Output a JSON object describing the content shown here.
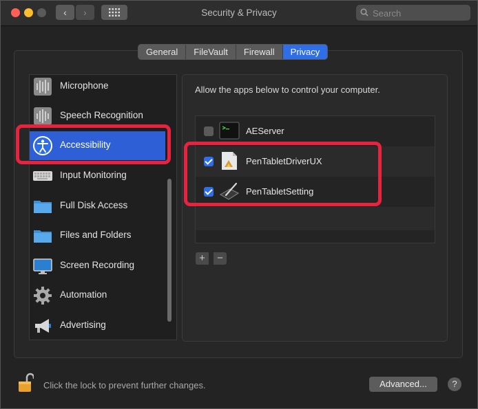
{
  "window": {
    "title": "Security & Privacy"
  },
  "search": {
    "placeholder": "Search"
  },
  "tabs": [
    {
      "label": "General",
      "active": false
    },
    {
      "label": "FileVault",
      "active": false
    },
    {
      "label": "Firewall",
      "active": false
    },
    {
      "label": "Privacy",
      "active": true
    }
  ],
  "sidebar": {
    "items": [
      {
        "label": "Microphone",
        "icon": "microphone-icon"
      },
      {
        "label": "Speech Recognition",
        "icon": "speech-recognition-icon"
      },
      {
        "label": "Accessibility",
        "icon": "accessibility-icon",
        "selected": true
      },
      {
        "label": "Input Monitoring",
        "icon": "keyboard-icon"
      },
      {
        "label": "Full Disk Access",
        "icon": "folder-icon"
      },
      {
        "label": "Files and Folders",
        "icon": "folder-icon"
      },
      {
        "label": "Screen Recording",
        "icon": "display-icon"
      },
      {
        "label": "Automation",
        "icon": "gear-icon"
      },
      {
        "label": "Advertising",
        "icon": "megaphone-icon"
      }
    ]
  },
  "main": {
    "description": "Allow the apps below to control your computer.",
    "apps": [
      {
        "name": "AEServer",
        "checked": false,
        "icon": "terminal-icon"
      },
      {
        "name": "PenTabletDriverUX",
        "checked": true,
        "icon": "pen-tablet-driver-icon"
      },
      {
        "name": "PenTabletSetting",
        "checked": true,
        "icon": "pen-tablet-icon"
      }
    ],
    "add_label": "+",
    "remove_label": "−"
  },
  "footer": {
    "lock_text": "Click the lock to prevent further changes.",
    "advanced_label": "Advanced...",
    "help_label": "?"
  },
  "colors": {
    "accent": "#2f6ee6",
    "highlight": "#e8233f"
  }
}
